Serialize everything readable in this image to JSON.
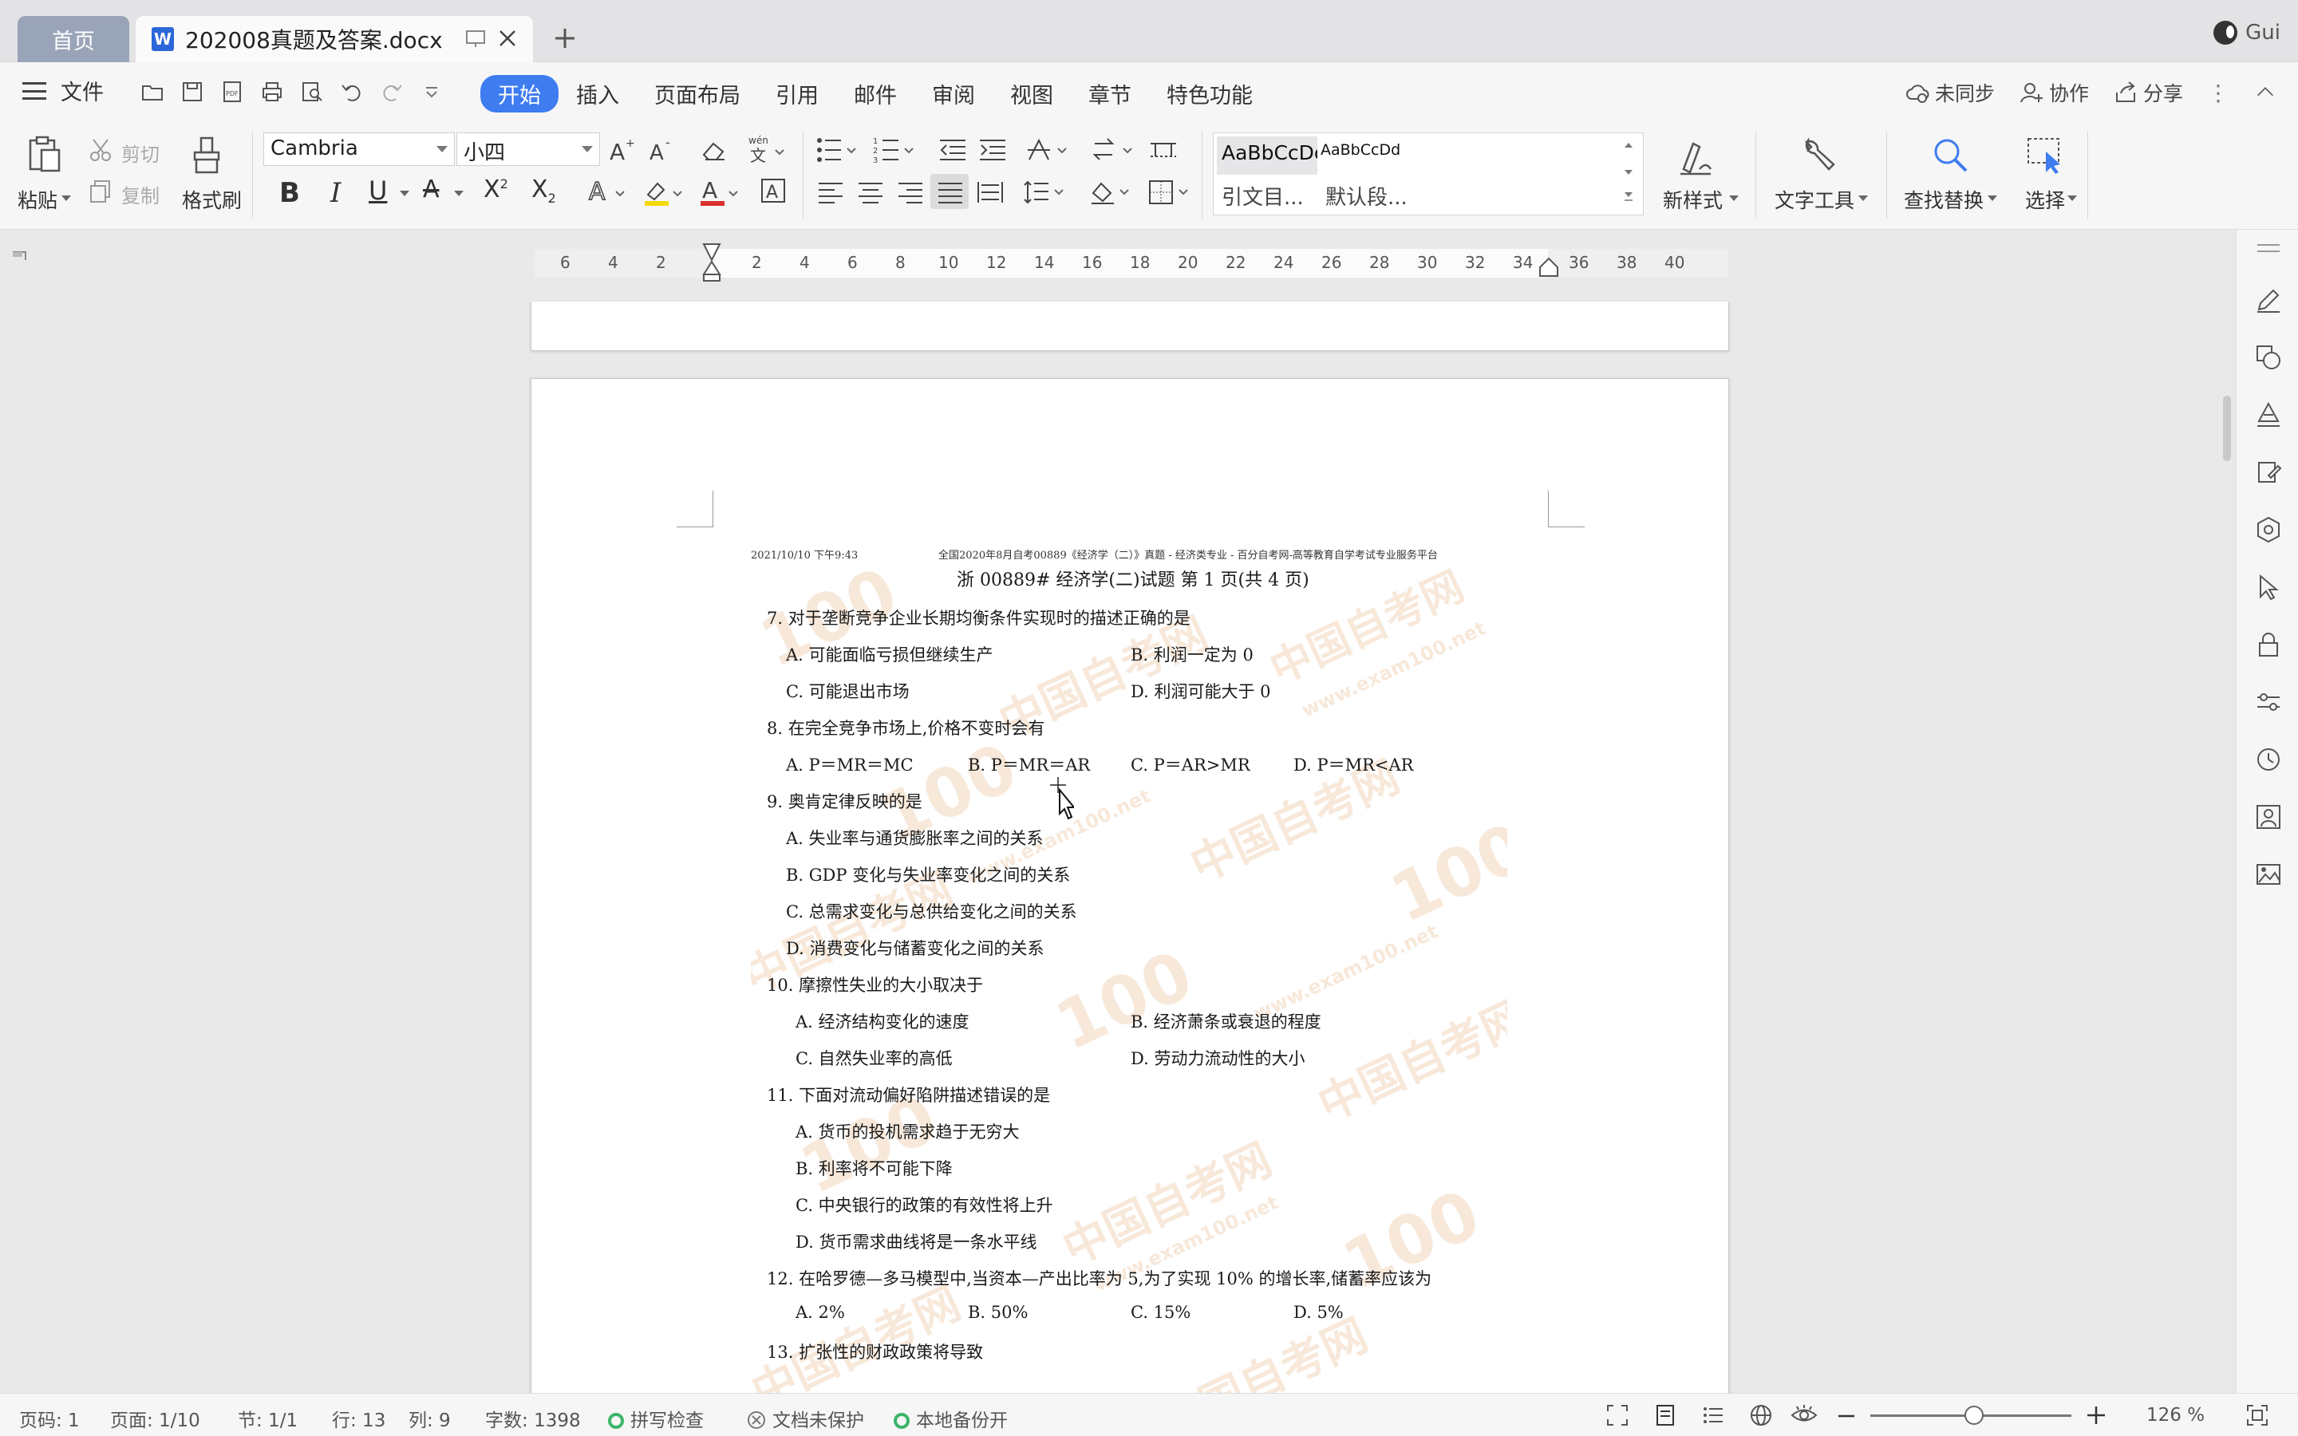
{
  "tabs": {
    "home": "首页",
    "doc_title": "202008真题及答案.docx",
    "new_tab": "+"
  },
  "user": {
    "name": "Gui"
  },
  "menu": {
    "file": "文件",
    "tabs": [
      "开始",
      "插入",
      "页面布局",
      "引用",
      "邮件",
      "审阅",
      "视图",
      "章节",
      "特色功能"
    ],
    "active_tab": "开始",
    "sync": "未同步",
    "collab": "协作",
    "share": "分享"
  },
  "ribbon": {
    "paste": "粘贴",
    "cut": "剪切",
    "copy": "复制",
    "format_painter": "格式刷",
    "font_name": "Cambria",
    "font_size": "小四",
    "style_sample_1": "AaBbCcDc",
    "style_sample_2": "AaBbCcDd",
    "style_name_1": "引文目...",
    "style_name_2": "默认段...",
    "new_style": "新样式",
    "text_tools": "文字工具",
    "find_replace": "查找替换",
    "select": "选择"
  },
  "ruler": {
    "labels": [
      "6",
      "4",
      "2",
      "2",
      "4",
      "6",
      "8",
      "10",
      "12",
      "14",
      "16",
      "18",
      "20",
      "22",
      "24",
      "26",
      "28",
      "30",
      "32",
      "34",
      "36",
      "38",
      "40"
    ]
  },
  "document": {
    "header_left": "2021/10/10 下午9:43",
    "header_center": "全国2020年8月自考00889《经济学（二）》真题 - 经济类专业 - 百分自考网-高等教育自学考试专业服务平台",
    "page_title": "浙 00889# 经济学(二)试题 第 1 页(共 4 页)",
    "watermark_text": "中国自考网",
    "watermark_url": "www.exam100.net",
    "watermark_num": "100",
    "lines": [
      "7. 对于垄断竞争企业长期均衡条件实现时的描述正确的是",
      "A. 可能面临亏损但继续生产",
      "B. 利润一定为 0",
      "C. 可能退出市场",
      "D. 利润可能大于 0",
      "8. 在完全竞争市场上,价格不变时会有",
      "A. P＝MR＝MC",
      "B. P＝MR＝AR",
      "C. P＝AR>MR",
      "D. P＝MR<AR",
      "9. 奥肯定律反映的是",
      "A. 失业率与通货膨胀率之间的关系",
      "B. GDP 变化与失业率变化之间的关系",
      "C. 总需求变化与总供给变化之间的关系",
      "D. 消费变化与储蓄变化之间的关系",
      "10. 摩擦性失业的大小取决于",
      "A. 经济结构变化的速度",
      "B. 经济萧条或衰退的程度",
      "C. 自然失业率的高低",
      "D. 劳动力流动性的大小",
      "11. 下面对流动偏好陷阱描述错误的是",
      "A. 货币的投机需求趋于无穷大",
      "B. 利率将不可能下降",
      "C. 中央银行的政策的有效性将上升",
      "D. 货币需求曲线将是一条水平线",
      "12. 在哈罗德—多马模型中,当资本—产出比率为 5,为了实现 10% 的增长率,储蓄率应该为",
      "A. 2%",
      "B. 50%",
      "C. 15%",
      "D. 5%",
      "13. 扩张性的财政政策将导致"
    ]
  },
  "status": {
    "page_code": "页码: 1",
    "page": "页面: 1/10",
    "section": "节: 1/1",
    "row": "行: 13",
    "col": "列: 9",
    "word_count": "字数: 1398",
    "spell_check": "拼写检查",
    "doc_protect": "文档未保护",
    "backup": "本地备份开",
    "zoom": "126 %",
    "zoom_level": 126
  },
  "colors": {
    "accent": "#3e7cf0",
    "tab_home": "#9aa4b8",
    "status_green": "#3db56b",
    "font_color_red": "#d9302c",
    "highlight_yellow": "#f5d90a"
  }
}
